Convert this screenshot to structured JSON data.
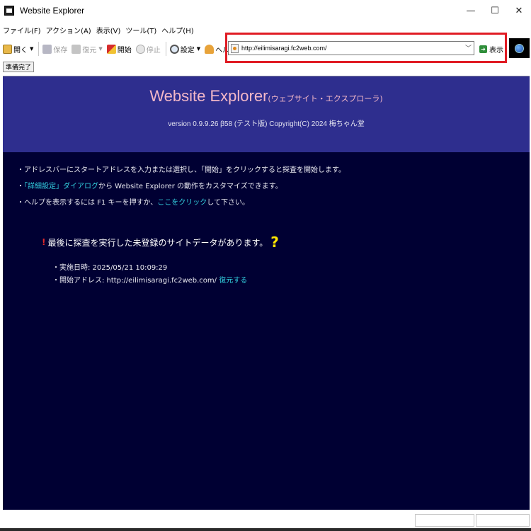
{
  "window": {
    "title": "Website Explorer"
  },
  "window_controls": {
    "minimize": "—",
    "maximize": "☐",
    "close": "✕"
  },
  "menu": [
    {
      "label": "ファイル(F)"
    },
    {
      "label": "アクション(A)"
    },
    {
      "label": "表示(V)"
    },
    {
      "label": "ツール(T)"
    },
    {
      "label": "ヘルプ(H)"
    }
  ],
  "toolbar": {
    "open": "開く",
    "save": "保存",
    "restore": "復元",
    "start": "開始",
    "stop": "停止",
    "settings": "設定",
    "help": "ヘルプ",
    "go": "表示"
  },
  "address": {
    "value": "http://eilimisaragi.fc2web.com/"
  },
  "status_button": "準備完了",
  "header": {
    "title_main": "Website Explorer",
    "title_sub": "(ウェブサイト・エクスプローラ)",
    "version": "version 0.9.9.26 β58 (テスト版) Copyright(C) 2024 梅ちゃん堂"
  },
  "bullets": {
    "line1": "・アドレスバーにスタートアドレスを入力または選択し、「開始」をクリックすると探査を開始します。",
    "line2_prefix": "・",
    "line2_link": "「詳細設定」ダイアログ",
    "line2_suffix": "から Website Explorer の動作をカスタマイズできます。",
    "line3_prefix": "・ヘルプを表示するには F1 キーを押すか、",
    "line3_link": "ここをクリック",
    "line3_suffix": "して下さい。"
  },
  "notice": {
    "mark": "!",
    "text": "最後に探査を実行した未登録のサイトデータがあります。",
    "question": "?"
  },
  "details": {
    "date_line": "・実施日時: 2025/05/21 10:09:29",
    "start_prefix": "・開始アドレス: http://eilimisaragi.fc2web.com/ ",
    "restore_link": "復元する"
  },
  "colors": {
    "header_bg": "#2e2e8e",
    "content_bg": "#000033",
    "title_pink": "#f3b8c8",
    "link_cyan": "#33d0e0",
    "highlight_red": "#e01c24",
    "question_yellow": "#ffe600"
  },
  "icons": {
    "app": "app-icon",
    "open": "folder-open-icon",
    "save": "floppy-icon",
    "restore": "restore-icon",
    "start": "start-flag-icon",
    "stop": "stop-icon",
    "settings": "magnifier-icon",
    "help": "help-person-icon",
    "go": "go-arrow-icon",
    "globe": "globe-icon"
  }
}
